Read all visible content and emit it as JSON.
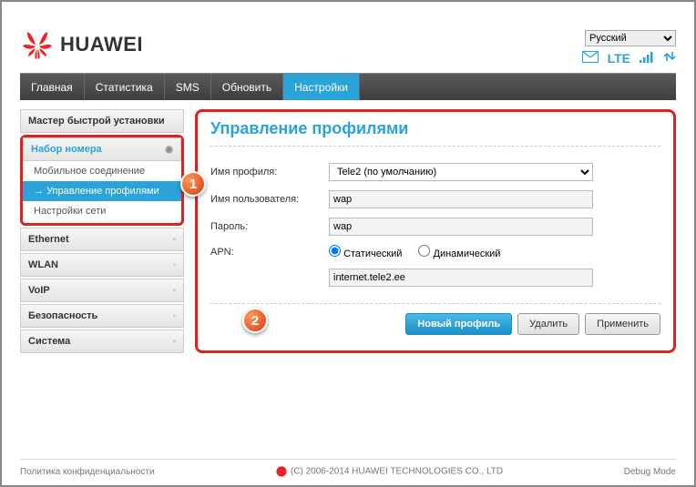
{
  "lang": {
    "selected": "Русский"
  },
  "logo": "HUAWEI",
  "status": {
    "network": "LTE"
  },
  "nav": {
    "items": [
      "Главная",
      "Статистика",
      "SMS",
      "Обновить",
      "Настройки"
    ],
    "activeIndex": 4
  },
  "sidebar": {
    "quick": "Мастер быстрой установки",
    "dialup_header": "Набор номера",
    "dialup_sub1": "Мобильное соединение",
    "dialup_sub2": "Управление профилями",
    "dialup_sub3": "Настройки сети",
    "ethernet": "Ethernet",
    "wlan": "WLAN",
    "voip": "VoIP",
    "security": "Безопасность",
    "system": "Система"
  },
  "page": {
    "title": "Управление профилями",
    "profile_name_label": "Имя профиля:",
    "profile_selected": "Tele2 (по умолчанию)",
    "username_label": "Имя пользователя:",
    "username_value": "wap",
    "password_label": "Пароль:",
    "password_value": "wap",
    "apn_label": "APN:",
    "apn_static": "Статический",
    "apn_dynamic": "Динамический",
    "apn_value": "internet.tele2.ee",
    "btn_new": "Новый профиль",
    "btn_delete": "Удалить",
    "btn_apply": "Применить"
  },
  "footer": {
    "privacy": "Политика конфиденциальности",
    "copyright": "(C) 2006-2014 HUAWEI TECHNOLOGIES CO., LTD",
    "debug": "Debug Mode"
  },
  "annotations": {
    "b1": "1",
    "b2": "2"
  }
}
